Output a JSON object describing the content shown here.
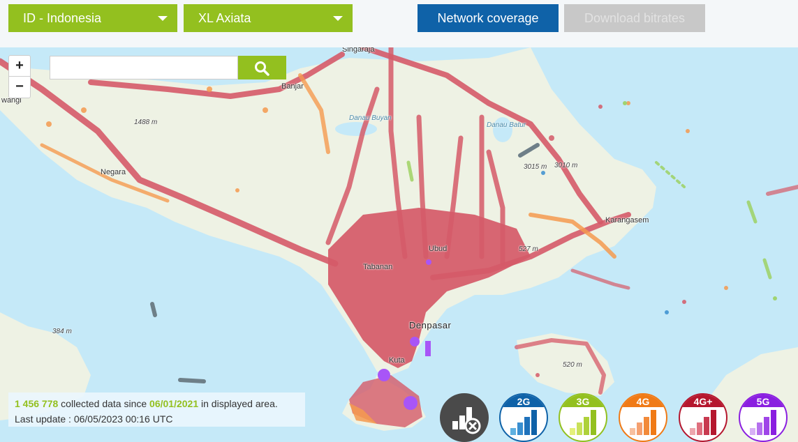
{
  "header": {
    "country_select": {
      "value": "ID - Indonesia"
    },
    "operator_select": {
      "value": "XL Axiata"
    },
    "tabs": [
      {
        "label": "Network coverage",
        "active": true
      },
      {
        "label": "Download bitrates",
        "active": false
      }
    ]
  },
  "map": {
    "zoom_in_label": "+",
    "zoom_out_label": "−",
    "search": {
      "value": "",
      "placeholder": ""
    },
    "labels": {
      "singaraja": "Singaraja",
      "banjar": "Banjar",
      "danau_buyan": "Danau Buyan",
      "danau_batur": "Danau Batur",
      "negara": "Negara",
      "elev_1488": "1488 m",
      "elev_3015": "3015 m",
      "elev_3010": "3010 m",
      "karangasem": "Karangasem",
      "elev_527": "527 m",
      "ubud": "Ubud",
      "tabanan": "Tabanan",
      "denpasar": "Denpasar",
      "kuta": "Kuta",
      "elev_520": "520 m",
      "elev_384": "384 m",
      "wangi": "wangi"
    }
  },
  "info": {
    "count": "1 456 778",
    "text1": " collected data since ",
    "since": "06/01/2021",
    "text2": " in displayed area.",
    "last_update": "Last update : 06/05/2023 00:16 UTC"
  },
  "legend": [
    {
      "id": "nocov",
      "label": "",
      "color": "#4a4a4a",
      "icon": "no-coverage-icon"
    },
    {
      "id": "2g",
      "label": "2G",
      "color": "#0f62a8",
      "shades": [
        "#5fb0e0",
        "#3a8fd0",
        "#1f72bb",
        "#0f62a8"
      ]
    },
    {
      "id": "3g",
      "label": "3G",
      "color": "#93c01f",
      "shades": [
        "#e4f07a",
        "#c9e15a",
        "#aed13a",
        "#93c01f"
      ]
    },
    {
      "id": "4g",
      "label": "4G",
      "color": "#f07a16",
      "shades": [
        "#f7c0a0",
        "#f5a070",
        "#f28a3a",
        "#f07a16"
      ]
    },
    {
      "id": "4gplus",
      "label": "4G+",
      "color": "#b5172e",
      "shades": [
        "#eda7ae",
        "#df6f7e",
        "#c83a50",
        "#b5172e"
      ]
    },
    {
      "id": "5g",
      "label": "5G",
      "color": "#8a1fe0",
      "shades": [
        "#d7b0f5",
        "#b570ee",
        "#9f45e8",
        "#8a1fe0"
      ]
    }
  ],
  "colors": {
    "brand_green": "#93c01f",
    "brand_blue": "#0f62a8",
    "sea": "#c5e9f8",
    "land": "#eef2e4",
    "cov_4gplus": "#d55a68",
    "cov_4g": "#f59a4f",
    "cov_3g": "#9ad05a",
    "cov_5g": "#a855f7"
  }
}
